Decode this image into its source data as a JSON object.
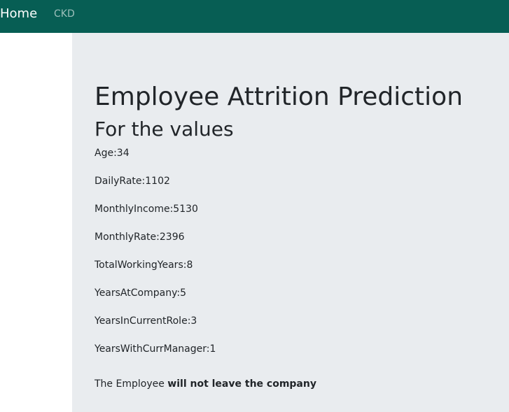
{
  "navbar": {
    "brand": "Home",
    "links": [
      "CKD"
    ],
    "background": "#075e54"
  },
  "main": {
    "title": "Employee Attrition Prediction",
    "subtitle": "For the values",
    "values": [
      {
        "label": "Age",
        "value": "34"
      },
      {
        "label": "DailyRate",
        "value": "1102"
      },
      {
        "label": "MonthlyIncome",
        "value": "5130"
      },
      {
        "label": "MonthlyRate",
        "value": "2396"
      },
      {
        "label": "TotalWorkingYears",
        "value": "8"
      },
      {
        "label": "YearsAtCompany",
        "value": "5"
      },
      {
        "label": "YearsInCurrentRole",
        "value": "3"
      },
      {
        "label": "YearsWithCurrManager",
        "value": "1"
      }
    ],
    "result_prefix": "The Employee ",
    "result_emphasis": "will not leave the company",
    "background": "#e9ecef"
  }
}
